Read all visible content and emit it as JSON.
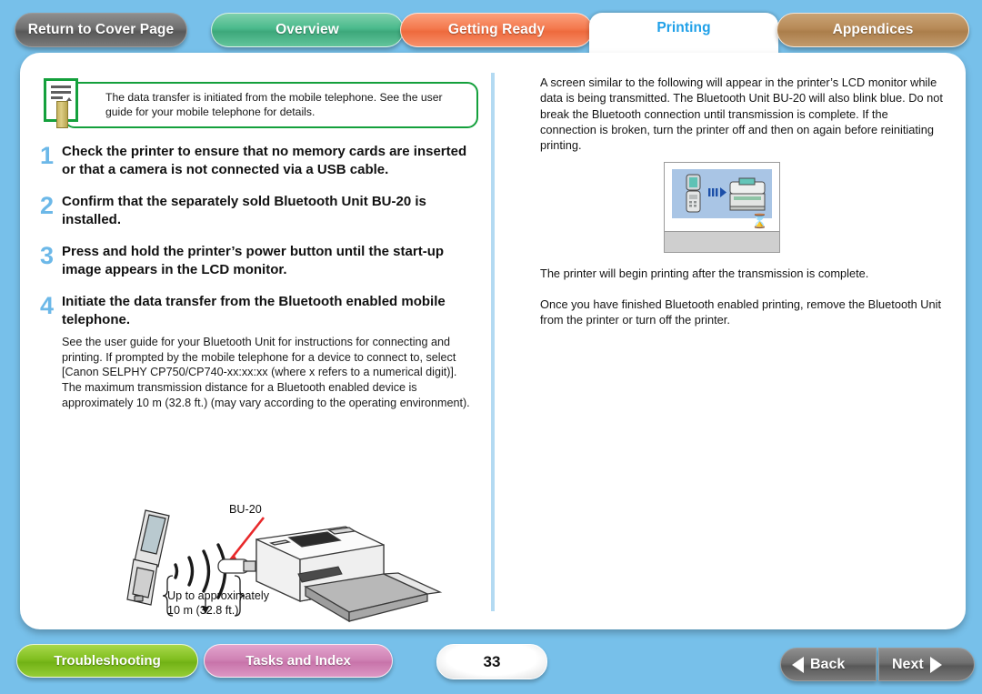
{
  "top_tabs": [
    {
      "id": "return-to-cover-page",
      "label": "Return to Cover Page"
    },
    {
      "id": "overview",
      "label": "Overview"
    },
    {
      "id": "getting-ready",
      "label": "Getting Ready"
    },
    {
      "id": "printing",
      "label": "Printing"
    },
    {
      "id": "appendices",
      "label": "Appendices"
    }
  ],
  "active_tab": "Printing",
  "note": {
    "icon": "memo-icon",
    "text": "The data transfer is initiated from the mobile telephone. See the user guide for your mobile telephone for details."
  },
  "steps": [
    {
      "number": "1",
      "title": "Check the printer to ensure that no memory cards are inserted or that a camera is not connected via a USB cable.",
      "sub": ""
    },
    {
      "number": "2",
      "title": "Confirm that the separately sold Bluetooth Unit BU-20 is installed.",
      "sub": ""
    },
    {
      "number": "3",
      "title": "Press and hold the printer’s power button until the start-up image appears in the LCD monitor.",
      "sub": ""
    },
    {
      "number": "4",
      "title": "Initiate the data transfer from the Bluetooth enabled mobile telephone.",
      "sub": "See the user guide for your Bluetooth Unit for instructions for connecting and printing. If prompted by the mobile telephone for a device to connect to, select [Canon SELPHY CP750/CP740-xx:xx:xx (where x refers to a numerical digit)]. The maximum transmission distance for a Bluetooth enabled device is approximately 10 m (32.8 ft.) (may vary according to the operating environment)."
    }
  ],
  "illustration": {
    "name": "mobile-phone-to-printer-diagram",
    "callout_label": "BU-20",
    "distance_label": "Up to approximately\n10 m (32.8 ft.)",
    "distance_line1": "Up to approximately",
    "distance_line2": "10 m (32.8 ft.)"
  },
  "right_column": {
    "paragraph1": "A screen similar to the following will appear in the printer’s LCD monitor while data is being transmitted. The Bluetooth Unit BU-20 will also blink blue. Do not break the Bluetooth connection until transmission is complete. If the connection is broken, turn the printer off and then on again before reinitiating printing.",
    "lcd_figure": "lcd-transmission-screen",
    "paragraph2": "The printer will begin printing after the transmission is complete.",
    "paragraph3": "Once you have finished Bluetooth enabled printing, remove the Bluetooth Unit from the printer or turn off the printer."
  },
  "bottom_bar": {
    "troubleshooting_label": "Troubleshooting",
    "tasks_index_label": "Tasks and Index",
    "page_number": "33",
    "back_label": "Back",
    "next_label": "Next"
  },
  "colors": {
    "background": "#77c0ea",
    "active_tab_text": "#1fa0e8",
    "step_number": "#6cb8e8",
    "note_border": "#14a03c",
    "overview_tab": "#4aba8c",
    "getting_ready_tab": "#f4794e",
    "appendices_tab": "#b78a57",
    "troubleshooting_btn": "#81bf20",
    "tasks_index_btn": "#d083b5",
    "divider": "#b3daf2"
  }
}
